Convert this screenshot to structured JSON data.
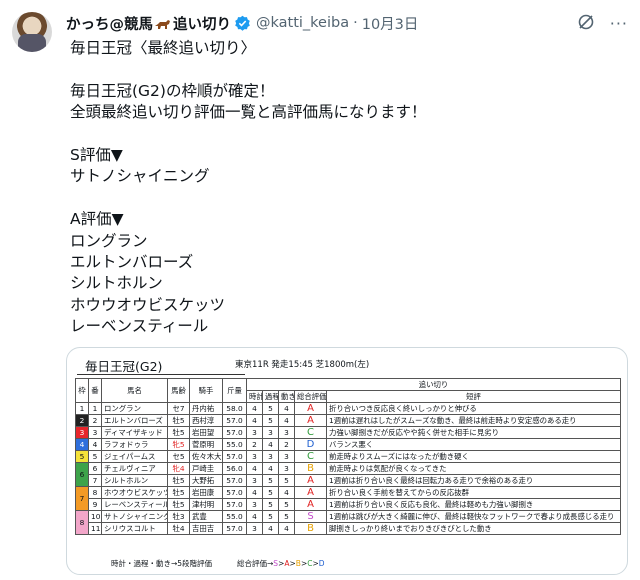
{
  "author": {
    "display_name": "かっち@競馬",
    "display_name_suffix": "追い切り",
    "handle": "@katti_keiba",
    "separator": "·",
    "date": "10月3日"
  },
  "icons": {
    "horse": "horse-emoji-icon",
    "verified": "verified-badge-icon",
    "grok": "grok-icon",
    "more": "more-icon"
  },
  "tweet_text": "毎日王冠〈最終追い切り〉\n\n毎日王冠(G2)の枠順が確定！\n全頭最終追い切り評価一覧と高評価馬になります！\n\nS評価▼\nサトノシャイニング\n\nA評価▼\nロングラン\nエルトンバローズ\nシルトホルン\nホウウオウビスケッツ\nレーベンスティール",
  "image": {
    "title": "毎日王冠(G2)",
    "race_info": "東京11R 発走15:45 芝1800m(左)",
    "headers": {
      "waku": "枠",
      "ban": "番",
      "horse": "馬名",
      "age": "馬齢",
      "jockey": "騎手",
      "weight": "斤量",
      "oikiri": "追い切り",
      "time": "時計",
      "process": "過程",
      "movement": "動き",
      "overall": "総合評価",
      "comment": "短評"
    },
    "rows": [
      {
        "waku": "1",
        "ban": "1",
        "horse": "ロングラン",
        "age": "セ7",
        "jockey": "丹内祐",
        "weight": "58.0",
        "time": "4",
        "process": "5",
        "movement": "4",
        "rank": "A",
        "comment": "折り合いつき反応良く終いしっかりと伸びる"
      },
      {
        "waku": "2",
        "ban": "2",
        "horse": "エルトンバローズ",
        "age": "牡5",
        "jockey": "西村淳",
        "weight": "57.0",
        "time": "4",
        "process": "5",
        "movement": "4",
        "rank": "A",
        "comment": "1週前は遅れはしたがスムーズな動き、最終は前走時より安定感のある走り"
      },
      {
        "waku": "3",
        "ban": "3",
        "horse": "ディマイザキッド",
        "age": "牡5",
        "jockey": "岩田望",
        "weight": "57.0",
        "time": "3",
        "process": "3",
        "movement": "3",
        "rank": "C",
        "comment": "力強い脚捌きだが反応やや鈍く併せた相手に見劣り"
      },
      {
        "waku": "4",
        "ban": "4",
        "horse": "ラフォドゥラ",
        "age": "牝5",
        "jockey": "菅原明",
        "weight": "55.0",
        "time": "2",
        "process": "4",
        "movement": "2",
        "rank": "D",
        "comment": "バランス悪く"
      },
      {
        "waku": "5",
        "ban": "5",
        "horse": "ジェイパームス",
        "age": "セ5",
        "jockey": "佐々木大",
        "weight": "57.0",
        "time": "3",
        "process": "3",
        "movement": "3",
        "rank": "C",
        "comment": "前走時よりスムーズにはなったが動き硬く"
      },
      {
        "waku": "6",
        "ban": "6",
        "horse": "チェルヴィニア",
        "age": "牝4",
        "jockey": "戸崎圭",
        "weight": "56.0",
        "time": "4",
        "process": "4",
        "movement": "3",
        "rank": "B",
        "comment": "前走時よりは気配が良くなってきた"
      },
      {
        "waku": "6",
        "ban": "7",
        "horse": "シルトホルン",
        "age": "牡5",
        "jockey": "大野拓",
        "weight": "57.0",
        "time": "3",
        "process": "5",
        "movement": "5",
        "rank": "A",
        "comment": "1週前は折り合い良く最終は回転力ある走りで余裕のある走り"
      },
      {
        "waku": "7",
        "ban": "8",
        "horse": "ホウオウビスケッツ",
        "age": "牡5",
        "jockey": "岩田康",
        "weight": "57.0",
        "time": "4",
        "process": "5",
        "movement": "4",
        "rank": "A",
        "comment": "折り合い良く手前を替えてからの反応抜群"
      },
      {
        "waku": "7",
        "ban": "9",
        "horse": "レーベンスティール",
        "age": "牡5",
        "jockey": "津村明",
        "weight": "57.0",
        "time": "3",
        "process": "5",
        "movement": "5",
        "rank": "A",
        "comment": "1週前は折り合い良く反応も良化、最終は軽めも力強い脚捌き"
      },
      {
        "waku": "8",
        "ban": "10",
        "horse": "サトノシャイニング",
        "age": "牡3",
        "jockey": "武豊",
        "weight": "55.0",
        "time": "4",
        "process": "5",
        "movement": "5",
        "rank": "S",
        "comment": "1週前は跳びが大きく綺麗に伸び、最終は軽快なフットワークで春より成長感じる走り"
      },
      {
        "waku": "8",
        "ban": "11",
        "horse": "シリウスコルト",
        "age": "牡4",
        "jockey": "吉田吉",
        "weight": "57.0",
        "time": "3",
        "process": "4",
        "movement": "4",
        "rank": "B",
        "comment": "脚捌きしっかり終いまでおりきびきびとした動き"
      }
    ],
    "footer_left": "時計・過程・動き→5段階評価",
    "footer_right_label": "総合評価→",
    "footer_scale": [
      "S",
      ">",
      "A",
      ">",
      "B",
      ">",
      "C",
      ">",
      "D"
    ],
    "waku_colors": {
      "1": "#ffffff",
      "2": "#222222",
      "3": "#e8262b",
      "4": "#2f6fdc",
      "5": "#f5e23a",
      "6": "#3ea34a",
      "7": "#f39a25",
      "8": "#f2a6c9"
    },
    "rank_colors": {
      "S": "#c24cc9",
      "A": "#e02020",
      "B": "#e6a000",
      "C": "#2f9b3a",
      "D": "#2060d0"
    }
  }
}
